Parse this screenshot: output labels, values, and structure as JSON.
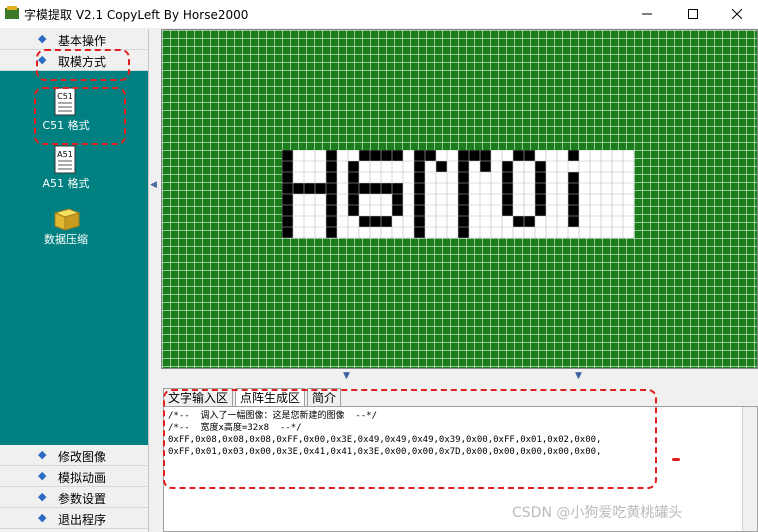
{
  "window": {
    "title": "字模提取 V2.1  CopyLeft By Horse2000"
  },
  "sidebar": {
    "top_sections": [
      {
        "label": "基本操作"
      },
      {
        "label": "取模方式"
      }
    ],
    "tools": [
      {
        "icon_text": "C51",
        "label": "C51 格式"
      },
      {
        "icon_text": "A51",
        "label": "A51 格式"
      },
      {
        "label": "数据压缩"
      }
    ],
    "bottom_sections": [
      {
        "label": "修改图像"
      },
      {
        "label": "模拟动画"
      },
      {
        "label": "参数设置"
      },
      {
        "label": "退出程序"
      }
    ]
  },
  "canvas": {
    "image_text": "Hello!"
  },
  "tabs": [
    {
      "label": "文字输入区"
    },
    {
      "label": "点阵生成区"
    },
    {
      "label": "简介"
    }
  ],
  "output": {
    "lines": [
      "/*--  调入了一幅图像：这是您新建的图像  --*/",
      "/*--  宽度x高度=32x8  --*/",
      "0xFF,0x08,0x08,0x08,0xFF,0x00,0x3E,0x49,0x49,0x49,0x39,0x00,0xFF,0x01,0x02,0x00,",
      "0xFF,0x01,0x03,0x00,0x3E,0x41,0x41,0x3E,0x00,0x00,0x7D,0x00,0x00,0x00,0x00,0x00,"
    ]
  },
  "watermark": "CSDN @小狗爱吃黄桃罐头",
  "colors": {
    "teal": "#008080",
    "grid_green": "#1a7f1a",
    "annotation_red": "#e02020"
  }
}
